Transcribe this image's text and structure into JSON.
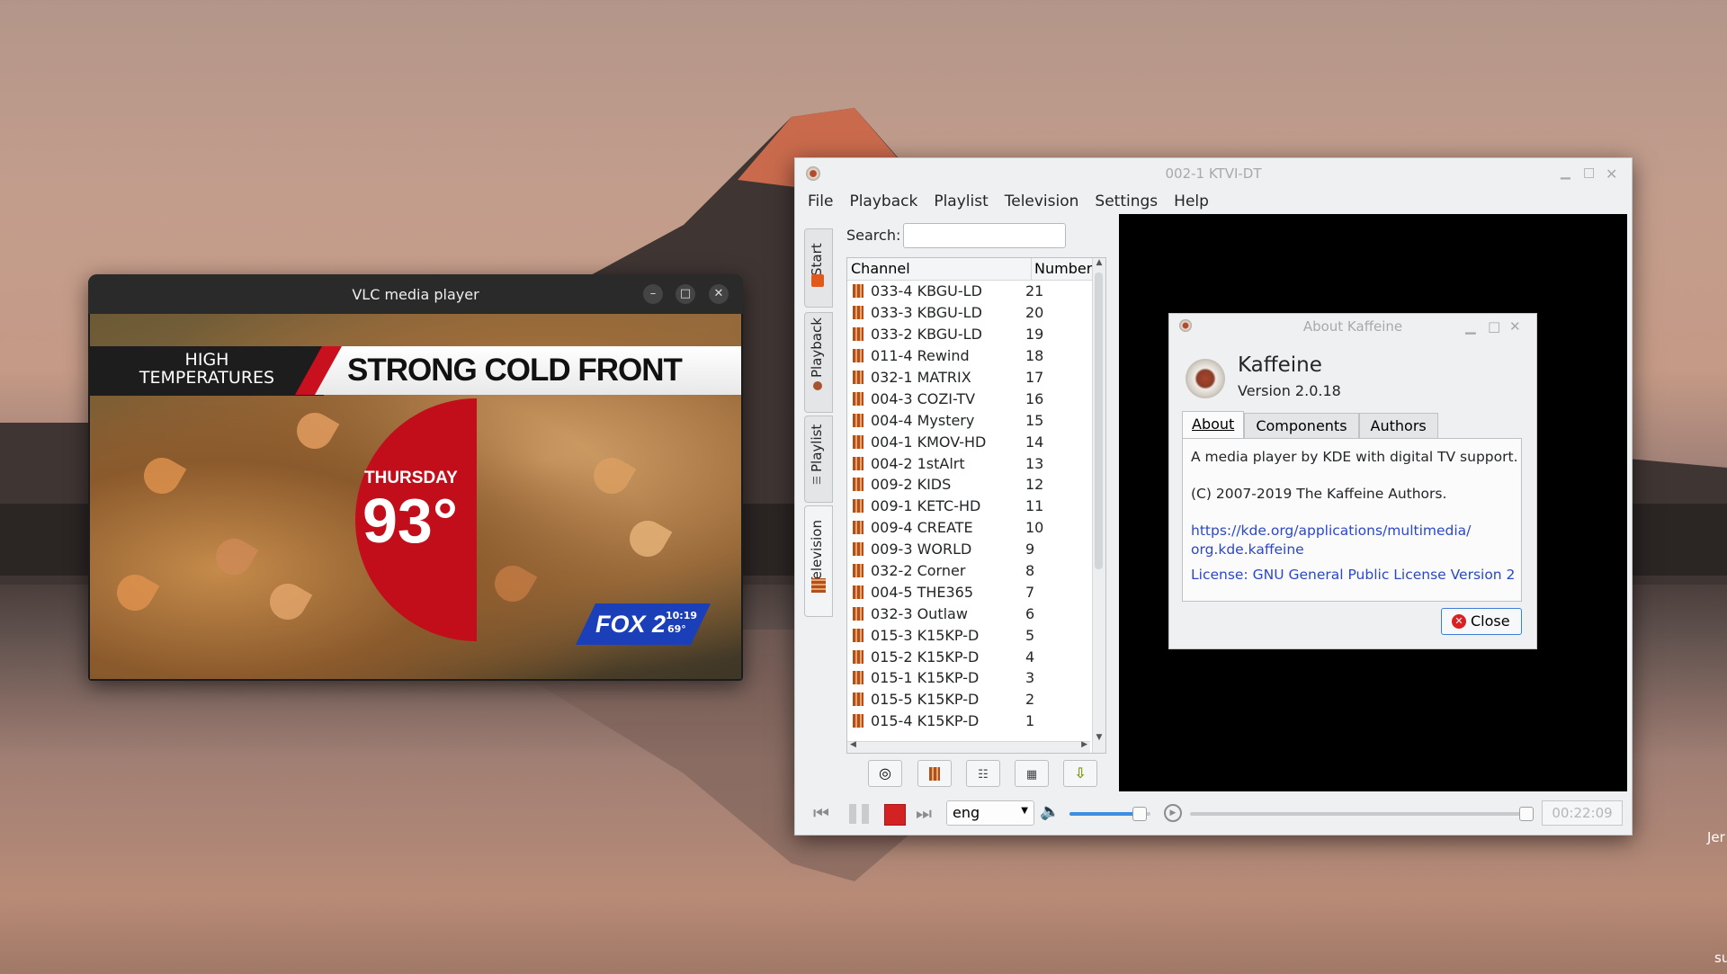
{
  "desktop": {
    "edge_text_1": "Jer",
    "edge_text_2": "su"
  },
  "vlc": {
    "title": "VLC media player",
    "controls": {
      "minimize": "–",
      "maximize": "□",
      "close": "✕"
    },
    "video": {
      "banner_left_line1": "HIGH",
      "banner_left_line2": "TEMPERATURES",
      "banner_right": "STRONG COLD FRONT",
      "day": "THURSDAY",
      "temp": "93°",
      "logo": "FOX 2",
      "time": "10:19",
      "small_temp": "69°"
    }
  },
  "kaffeine": {
    "title": "002-1 KTVI-DT",
    "menu": [
      "File",
      "Playback",
      "Playlist",
      "Television",
      "Settings",
      "Help"
    ],
    "side_tabs": [
      "Start",
      "Playback",
      "Playlist",
      "Television"
    ],
    "search_label": "Search:",
    "search_value": "",
    "columns": [
      "Channel",
      "Number"
    ],
    "channels": [
      [
        "033-4 KBGU-LD",
        "21"
      ],
      [
        "033-3 KBGU-LD",
        "20"
      ],
      [
        "033-2 KBGU-LD",
        "19"
      ],
      [
        "011-4 Rewind",
        "18"
      ],
      [
        "032-1 MATRIX",
        "17"
      ],
      [
        "004-3 COZI-TV",
        "16"
      ],
      [
        "004-4 Mystery",
        "15"
      ],
      [
        "004-1 KMOV-HD",
        "14"
      ],
      [
        "004-2 1stAlrt",
        "13"
      ],
      [
        "009-2 KIDS",
        "12"
      ],
      [
        "009-1 KETC-HD",
        "11"
      ],
      [
        "009-4 CREATE",
        "10"
      ],
      [
        "009-3 WORLD",
        "9"
      ],
      [
        "032-2 Corner",
        "8"
      ],
      [
        "004-5 THE365",
        "7"
      ],
      [
        "032-3 Outlaw",
        "6"
      ],
      [
        "015-3 K15KP-D",
        "5"
      ],
      [
        "015-2 K15KP-D",
        "4"
      ],
      [
        "015-1 K15KP-D",
        "3"
      ],
      [
        "015-5 K15KP-D",
        "2"
      ],
      [
        "015-4 K15KP-D",
        "1"
      ]
    ],
    "language": "eng",
    "time": "00:22:09",
    "volume_level": 0.85,
    "seek_level": 1.0
  },
  "about": {
    "title": "About Kaffeine",
    "app": "Kaffeine",
    "version": "Version 2.0.18",
    "tabs": [
      "About",
      "Components",
      "Authors"
    ],
    "description": "A media player by KDE with digital TV support.",
    "copyright": "(C) 2007-2019 The Kaffeine Authors.",
    "link1": "https://kde.org/applications/multimedia/",
    "link2": "org.kde.kaffeine",
    "license": "License: GNU General Public License Version 2",
    "close": "Close"
  }
}
